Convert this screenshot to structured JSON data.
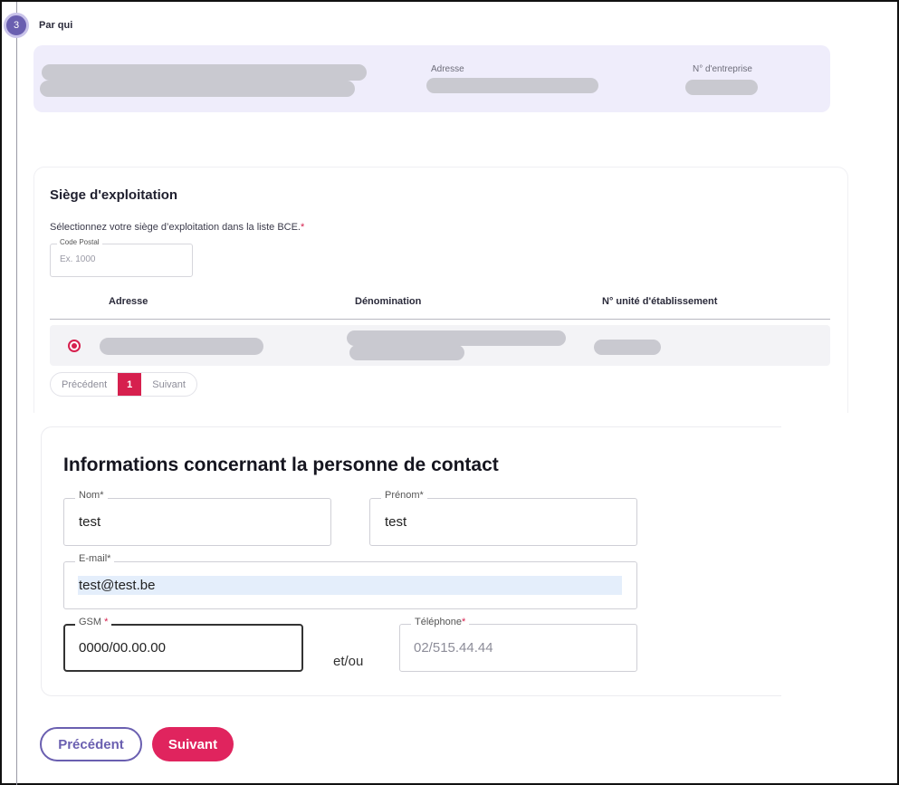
{
  "step": {
    "number": "3",
    "title": "Par qui"
  },
  "company": {
    "address_label": "Adresse",
    "enterprise_label": "N° d'entreprise"
  },
  "siege": {
    "title": "Siège d'exploitation",
    "hint": "Sélectionnez votre siège d’exploitation dans la liste BCE.",
    "required_mark": "*",
    "postal_label": "Code Postal",
    "postal_placeholder": "Ex. 1000",
    "columns": [
      "Adresse",
      "Dénomination",
      "N° unité d'établissement"
    ],
    "pager": {
      "prev": "Précédent",
      "current": "1",
      "next": "Suivant"
    }
  },
  "contact": {
    "title": "Informations concernant la personne de contact",
    "nom_label": "Nom*",
    "nom_value": "test",
    "prenom_label": "Prénom*",
    "prenom_value": "test",
    "email_label": "E-mail*",
    "email_value": "test@test.be",
    "gsm_label": "GSM",
    "gsm_req": "*",
    "gsm_value": "0000/00.00.00",
    "or_text": "et/ou",
    "tel_label": "Téléphone",
    "tel_req": "*",
    "tel_placeholder": "02/515.44.44"
  },
  "nav": {
    "prev": "Précédent",
    "next": "Suivant"
  },
  "colors": {
    "accent": "#6a5fb0",
    "brand": "#e0245e",
    "card_bg": "#efedfb"
  }
}
